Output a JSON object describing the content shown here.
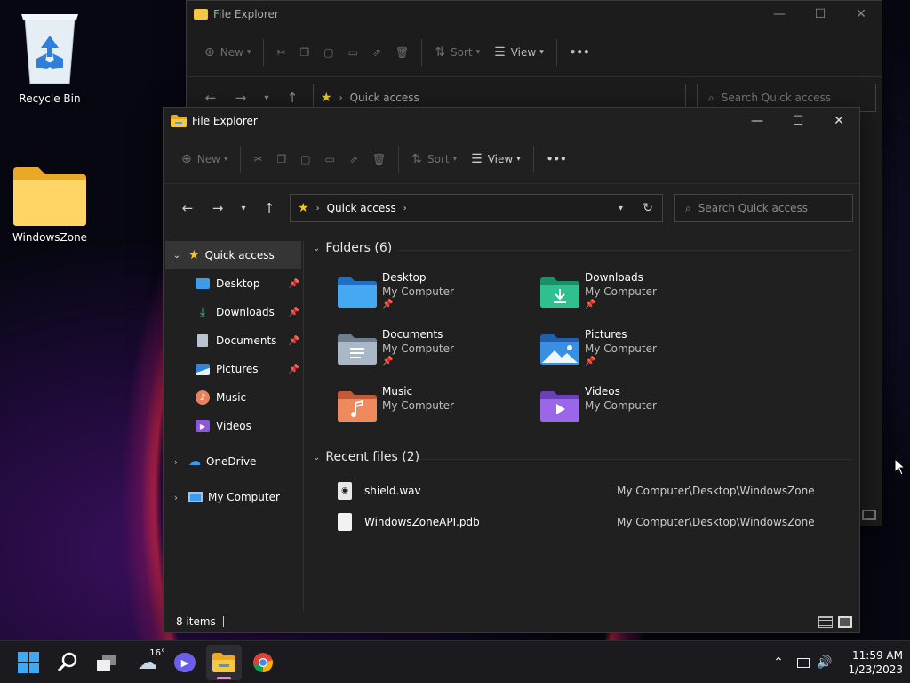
{
  "desktop": {
    "recycle_bin_label": "Recycle Bin",
    "folder_label": "WindowsZone"
  },
  "bg_window": {
    "title": "File Explorer",
    "toolbar": {
      "new_label": "New",
      "sort_label": "Sort",
      "view_label": "View"
    },
    "address_location": "Quick access",
    "search_placeholder": "Search Quick access"
  },
  "window": {
    "title": "File Explorer",
    "toolbar": {
      "new_label": "New",
      "sort_label": "Sort",
      "view_label": "View",
      "more_label": "•••"
    },
    "address_location": "Quick access",
    "search_placeholder": "Search Quick access",
    "sidebar": {
      "quick_access": "Quick access",
      "pinned": [
        {
          "label": "Desktop"
        },
        {
          "label": "Downloads"
        },
        {
          "label": "Documents"
        },
        {
          "label": "Pictures"
        }
      ],
      "others": [
        {
          "label": "Music"
        },
        {
          "label": "Videos"
        }
      ],
      "onedrive": "OneDrive",
      "my_computer": "My Computer"
    },
    "folders_header": "Folders (6)",
    "folders": [
      {
        "name": "Desktop",
        "sub": "My Computer"
      },
      {
        "name": "Downloads",
        "sub": "My Computer"
      },
      {
        "name": "Documents",
        "sub": "My Computer"
      },
      {
        "name": "Pictures",
        "sub": "My Computer"
      },
      {
        "name": "Music",
        "sub": "My Computer"
      },
      {
        "name": "Videos",
        "sub": "My Computer"
      }
    ],
    "recent_header": "Recent files (2)",
    "recent": [
      {
        "name": "shield.wav",
        "path": "My Computer\\Desktop\\WindowsZone"
      },
      {
        "name": "WindowsZoneAPI.pdb",
        "path": "My Computer\\Desktop\\WindowsZone"
      }
    ],
    "status": "8 items"
  },
  "taskbar": {
    "weather_temp": "16°",
    "time": "11:59 AM",
    "date": "1/23/2023"
  },
  "colors": {
    "accent": "#60cdff",
    "folder_yellow": "#f6c744",
    "star": "#f5c518"
  }
}
